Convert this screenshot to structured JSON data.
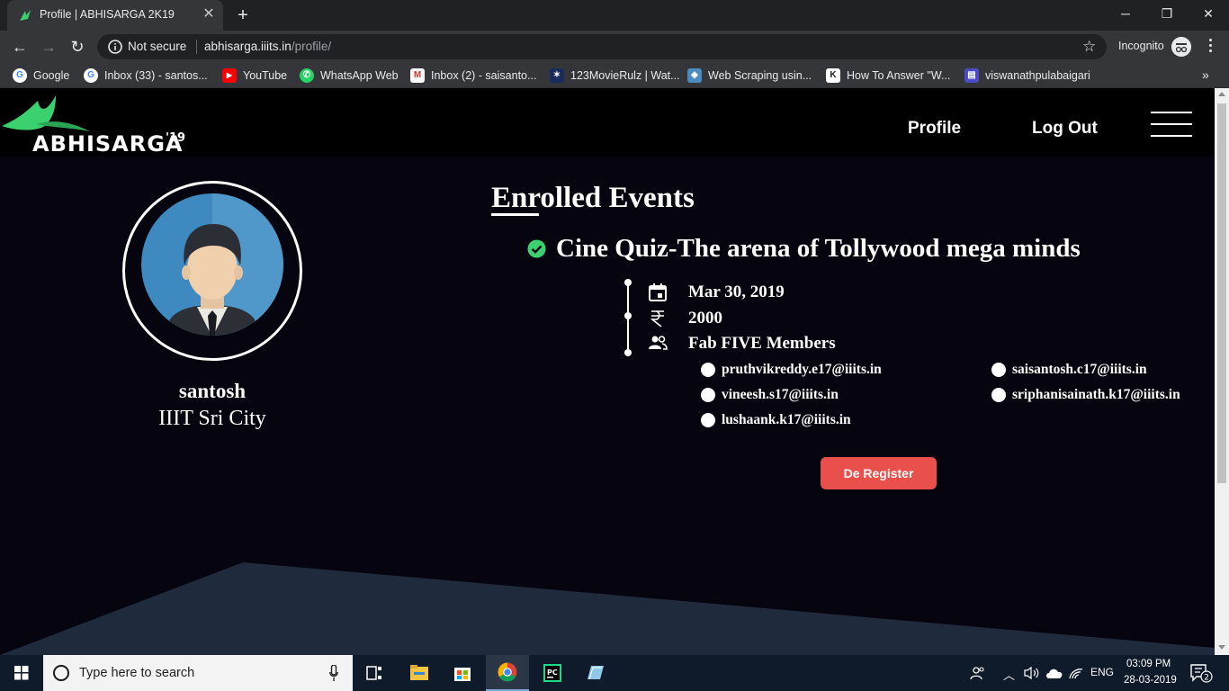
{
  "browser": {
    "tab_title": "Profile | ABHISARGA 2K19",
    "tab_close": "✕",
    "new_tab": "+",
    "security": "Not secure",
    "url_host": "abhisarga.iiits.in",
    "url_path": "/profile/",
    "mode_label": "Incognito",
    "window_controls": {
      "minimize": "─",
      "restore": "❐",
      "close": "✕"
    },
    "nav": {
      "back": "←",
      "forward": "→",
      "reload": "↻"
    },
    "star": "☆",
    "bookmarks_more": "»",
    "bookmarks": [
      {
        "label": "Google",
        "icon": "google-icon",
        "glyph": "G",
        "color": "#4285f4"
      },
      {
        "label": "Inbox (33) - santos...",
        "icon": "google-icon",
        "glyph": "G",
        "color": "#4285f4"
      },
      {
        "label": "YouTube",
        "icon": "youtube-icon",
        "glyph": "▶",
        "color": "#ff0000"
      },
      {
        "label": "WhatsApp Web",
        "icon": "whatsapp-icon",
        "glyph": "✆",
        "color": "#25d366"
      },
      {
        "label": "Inbox (2) - saisanto...",
        "icon": "gmail-icon",
        "glyph": "M",
        "color": "#d93025"
      },
      {
        "label": "123MovieRulz | Wat...",
        "icon": "movie-icon",
        "glyph": "✶",
        "color": "#1a2a5a"
      },
      {
        "label": "Web Scraping usin...",
        "icon": "shield-icon",
        "glyph": "◈",
        "color": "#4c8bbf"
      },
      {
        "label": "How To Answer \"W...",
        "icon": "k-icon",
        "glyph": "K",
        "color": "#ffffff"
      },
      {
        "label": "viswanathpulabaigari",
        "icon": "site-icon",
        "glyph": "▤",
        "color": "#4b4bc6"
      }
    ]
  },
  "site": {
    "logo_text": "ABHISARGA",
    "logo_year": "'19",
    "nav": {
      "profile": "Profile",
      "logout": "Log Out"
    },
    "colors": {
      "accent_green": "#3bd16f",
      "button_red": "#e9504b",
      "page_bg": "#05040f"
    }
  },
  "profile": {
    "name": "santosh",
    "college": "IIIT Sri City"
  },
  "enrolled": {
    "heading": "Enrolled Events",
    "event": {
      "title": "Cine Quiz-The arena of Tollywood mega minds",
      "date": "Mar 30, 2019",
      "fee": "2000",
      "team": "Fab FIVE Members",
      "members": [
        "pruthvikreddy.e17@iiits.in",
        "saisantosh.c17@iiits.in",
        "vineesh.s17@iiits.in",
        "sriphanisainath.k17@iiits.in",
        "lushaank.k17@iiits.in"
      ],
      "button": "De Register"
    }
  },
  "taskbar": {
    "search_placeholder": "Type here to search",
    "language": "ENG",
    "time": "03:09 PM",
    "date": "28-03-2019",
    "notifications": "2"
  }
}
